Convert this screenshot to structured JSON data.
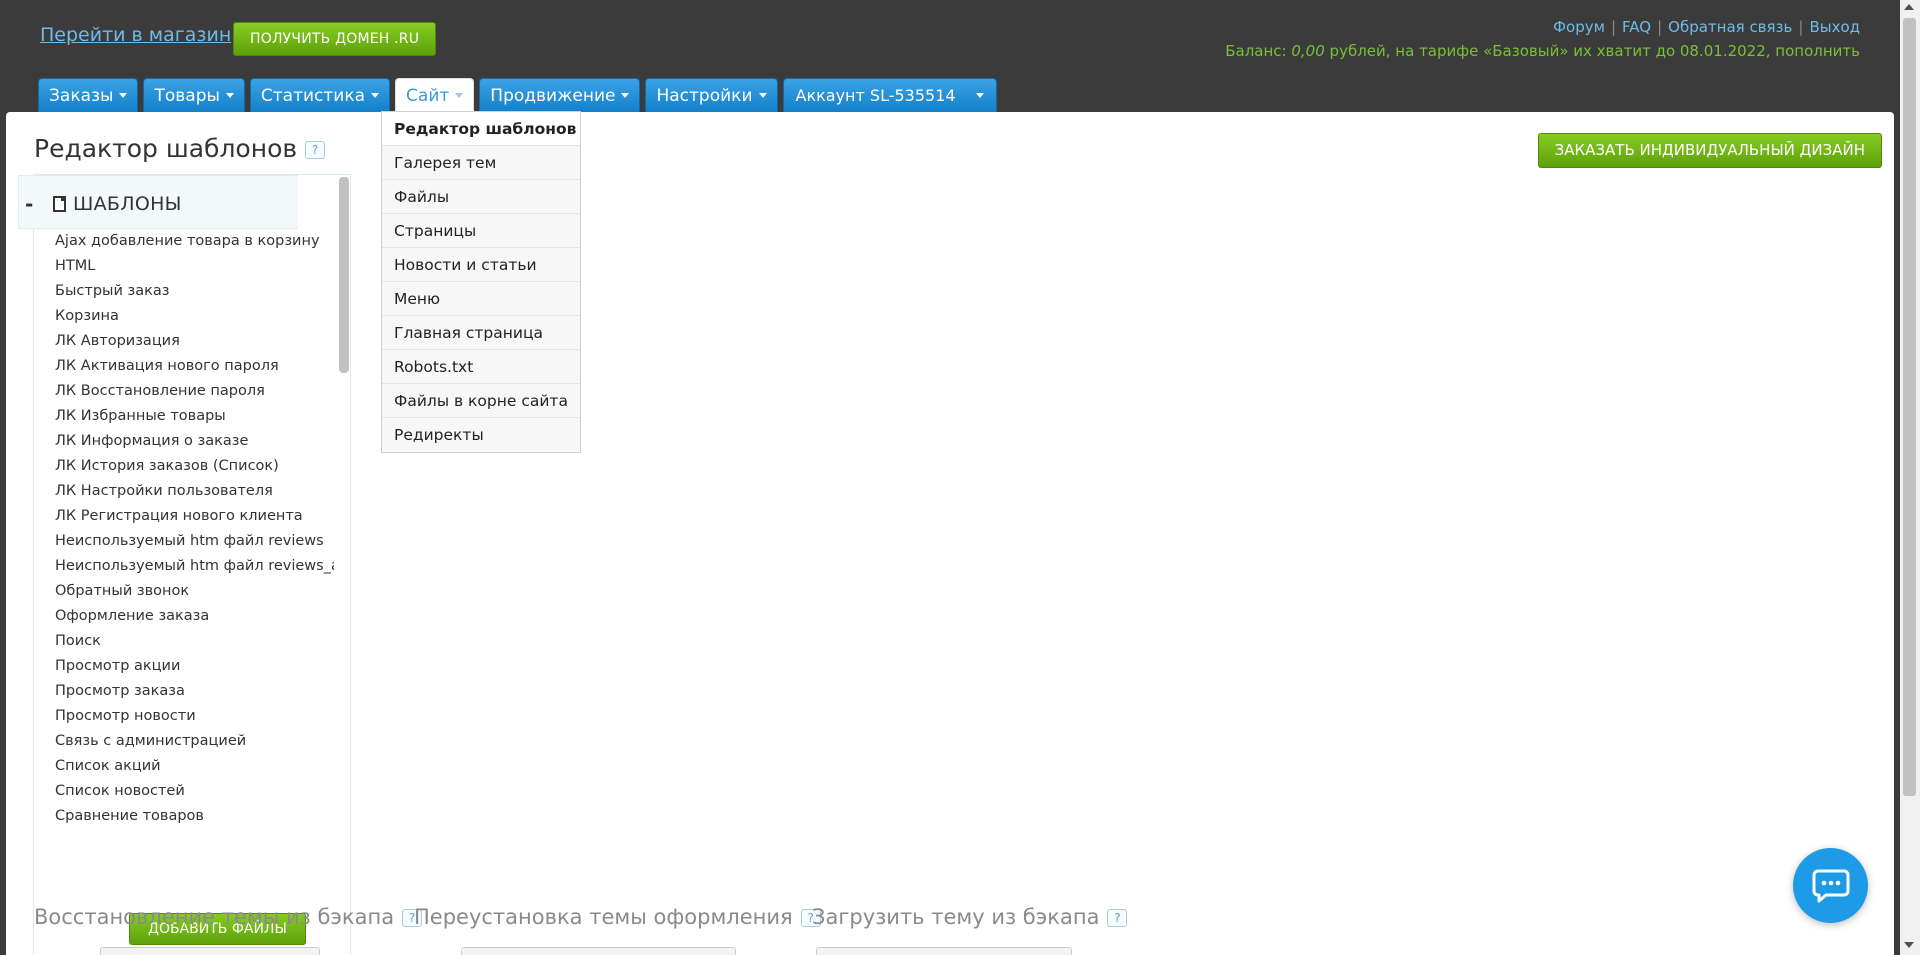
{
  "header": {
    "shop_link": "Перейти в магазин",
    "domain_button": "ПОЛУЧИТЬ ДОМЕН .RU",
    "links": [
      "Форум",
      "FAQ",
      "Обратная связь",
      "Выход"
    ],
    "balance_prefix": "Баланс: ",
    "balance_amount": "0,00",
    "balance_suffix": " рублей, на тарифе «Базовый» их хватит до 08.01.2022, пополнить"
  },
  "tabs": [
    {
      "label": "Заказы"
    },
    {
      "label": "Товары"
    },
    {
      "label": "Статистика"
    },
    {
      "label": "Сайт"
    },
    {
      "label": "Продвижение"
    },
    {
      "label": "Настройки"
    },
    {
      "label": "Аккаунт SL-535514"
    }
  ],
  "page": {
    "title": "Редактор шаблонов",
    "help": "?",
    "order_design_button": "ЗАКАЗАТЬ ИНДИВИДУАЛЬНЫЙ ДИЗАЙН"
  },
  "templates": {
    "collapse": "-",
    "heading": "ШАБЛОНЫ",
    "items": [
      "Ajax добавление товара в корзину",
      "HTML",
      "Быстрый заказ",
      "Корзина",
      "ЛК Авторизация",
      "ЛК Активация нового пароля",
      "ЛК Восстановление пароля",
      "ЛК Избранные товары",
      "ЛК Информация о заказе",
      "ЛК История заказов (Список)",
      "ЛК Настройки пользователя",
      "ЛК Регистрация нового клиента",
      "Неиспользуемый htm файл reviews",
      "Неиспользуемый htm файл reviews_add",
      "Обратный звонок",
      "Оформление заказа",
      "Поиск",
      "Просмотр акции",
      "Просмотр заказа",
      "Просмотр новости",
      "Связь с администрацией",
      "Список акций",
      "Список новостей",
      "Сравнение товаров"
    ],
    "add_files_button": "ДОБАВИТЬ ФАЙЛЫ"
  },
  "sections": [
    {
      "title": "Восстановление темы из бэкапа"
    },
    {
      "title": "Переустановка темы оформления"
    },
    {
      "title": "Загрузить тему из бэкапа"
    }
  ],
  "site_menu": [
    "Редактор шаблонов",
    "Галерея тем",
    "Файлы",
    "Страницы",
    "Новости и статьи",
    "Меню",
    "Главная страница",
    "Robots.txt",
    "Файлы в корне сайта",
    "Редиректы"
  ],
  "colors": {
    "accent_blue": "#1e9be6",
    "green_button": "#6cb315",
    "balance_green": "#78c035",
    "header_bg": "#3b3b3b"
  },
  "icons": {
    "doc": "document-icon",
    "chat": "chat-icon",
    "caret": "caret-down-icon"
  }
}
